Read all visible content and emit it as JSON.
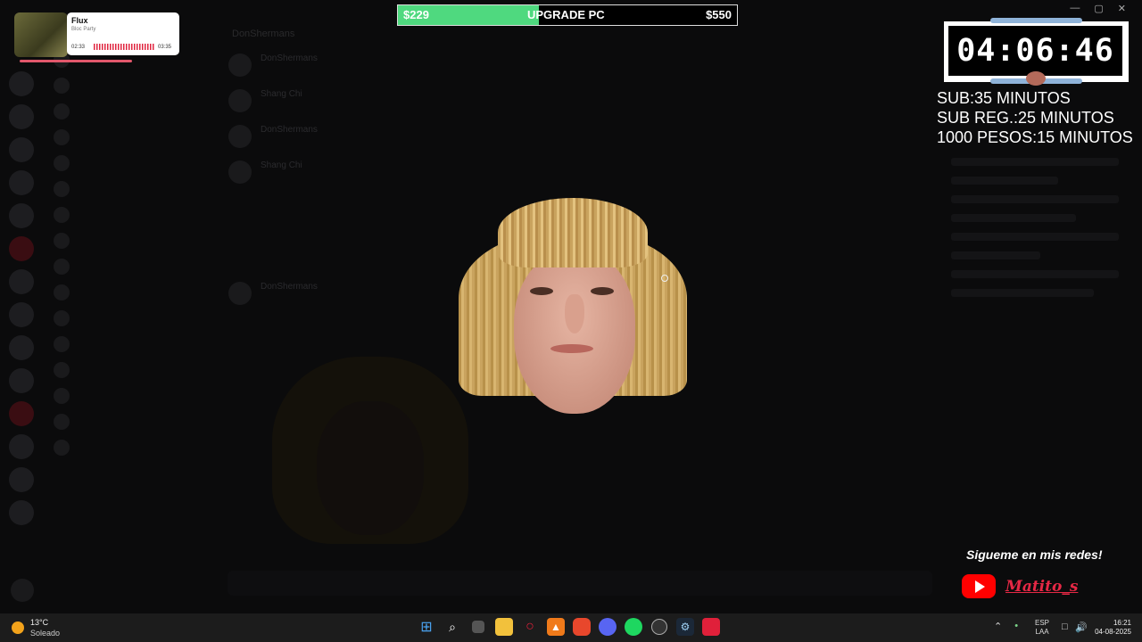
{
  "now_playing": {
    "title": "Flux",
    "artist": "Bloc Party",
    "elapsed": "02:33",
    "duration": "03:35",
    "progress_fraction": 0.71
  },
  "goal": {
    "current": "$229",
    "label": "UPGRADE PC",
    "target": "$550",
    "progress_fraction": 0.416,
    "color": "#4fd97f"
  },
  "timer": {
    "value": "04:06:46"
  },
  "rates": [
    "SUB:35 MINUTOS",
    "SUB REG.:25 MINUTOS",
    "1000 PESOS:15 MINUTOS"
  ],
  "social": {
    "title": "Sigueme en mis redes!",
    "handle": "Matito_s",
    "platform_icon": "youtube-icon"
  },
  "background_chat": {
    "channel_header": "DonShermans",
    "messages": [
      {
        "author": "DonShermans",
        "text": ""
      },
      {
        "author": "Shang Chi",
        "text": ""
      },
      {
        "author": "DonShermans",
        "text": ""
      },
      {
        "author": "Shang Chi",
        "text": ""
      },
      {
        "author": "DonShermans",
        "text": ""
      }
    ]
  },
  "taskbar": {
    "weather": {
      "temp": "13°C",
      "condition": "Soleado"
    },
    "apps": [
      "windows-start-icon",
      "search-icon",
      "task-view-icon",
      "file-explorer-icon",
      "opera-icon",
      "vlc-icon",
      "brave-icon",
      "discord-icon",
      "spotify-icon",
      "obs-icon",
      "steam-icon",
      "app-red-icon"
    ],
    "language": [
      "ESP",
      "LAA"
    ],
    "time": "16:21",
    "date": "04-08-2025"
  }
}
